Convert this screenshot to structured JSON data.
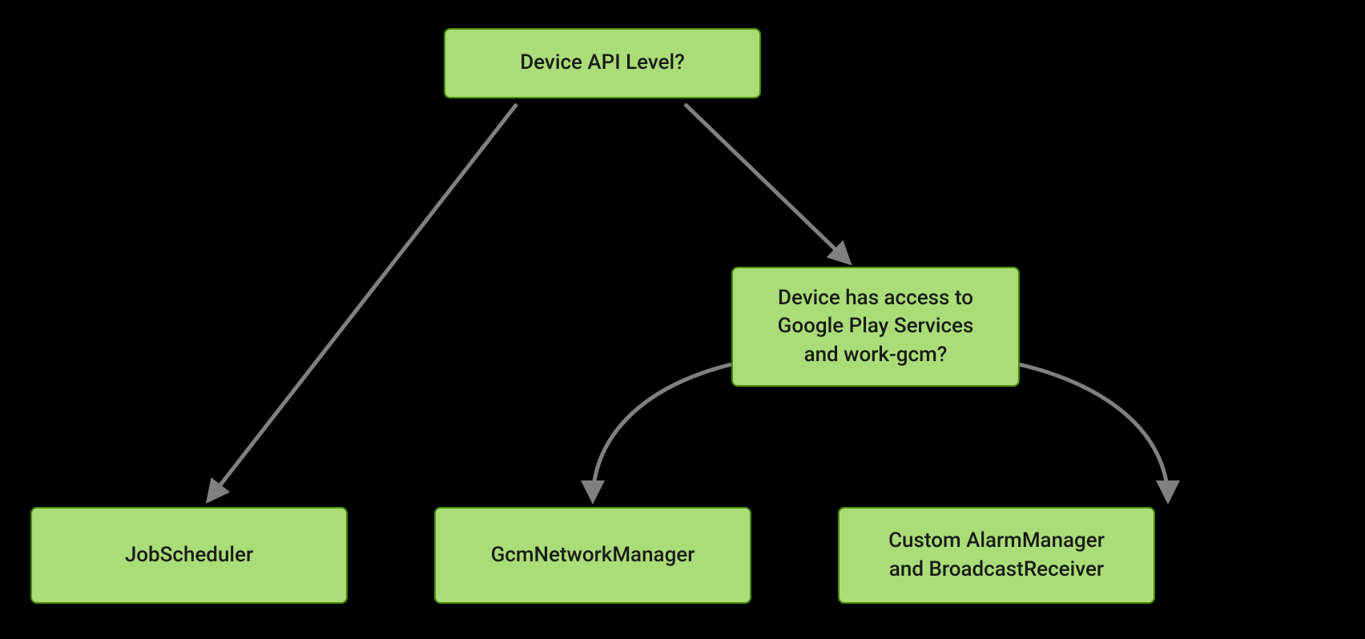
{
  "diagram": {
    "nodes": {
      "root": {
        "label": "Device API Level?"
      },
      "playServices": {
        "label": "Device has access to\nGoogle Play Services\nand work-gcm?"
      },
      "jobScheduler": {
        "label": "JobScheduler"
      },
      "gcmNetworkManager": {
        "label": "GcmNetworkManager"
      },
      "alarmManager": {
        "label": "Custom AlarmManager\nand BroadcastReceiver"
      }
    },
    "edges": [
      {
        "from": "root",
        "to": "jobScheduler"
      },
      {
        "from": "root",
        "to": "playServices"
      },
      {
        "from": "playServices",
        "to": "gcmNetworkManager"
      },
      {
        "from": "playServices",
        "to": "alarmManager"
      }
    ],
    "colors": {
      "nodeFill": "#aadd77",
      "nodeBorder": "#4a8a0a",
      "arrow": "#808080",
      "background": "#000000"
    }
  }
}
